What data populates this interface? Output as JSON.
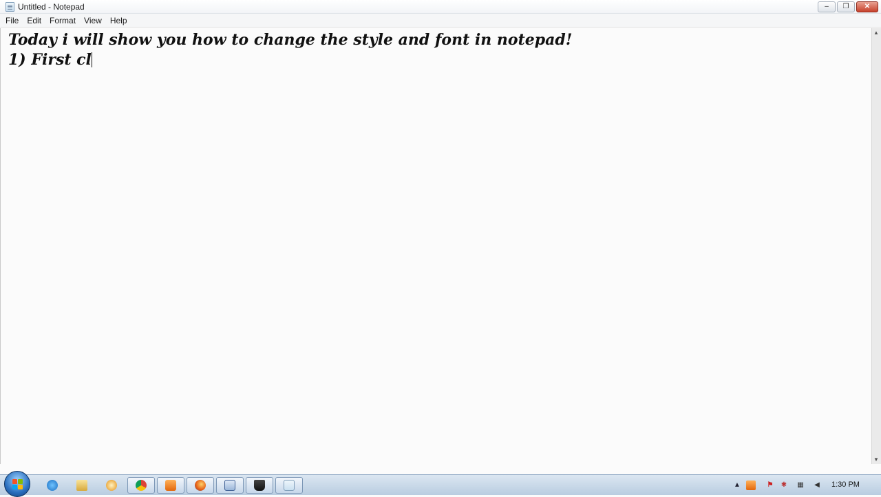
{
  "window": {
    "title": "Untitled - Notepad",
    "controls": {
      "minimize": "–",
      "maximize": "❐",
      "close": "✕"
    }
  },
  "menu": [
    "File",
    "Edit",
    "Format",
    "View",
    "Help"
  ],
  "editor": {
    "lines": [
      "Today i will show you how to change the style and font in notepad!",
      "1) First cl"
    ]
  },
  "taskbar": {
    "apps": [
      {
        "icon": "internet-explorer-icon"
      },
      {
        "icon": "folder-icon"
      },
      {
        "icon": "media-player-icon"
      },
      {
        "icon": "chrome-icon"
      },
      {
        "icon": "orange-app-icon"
      },
      {
        "icon": "firefox-icon"
      },
      {
        "icon": "word-icon"
      },
      {
        "icon": "hat-app-icon"
      },
      {
        "icon": "notepad-icon"
      }
    ],
    "clock": "1:30 PM"
  }
}
